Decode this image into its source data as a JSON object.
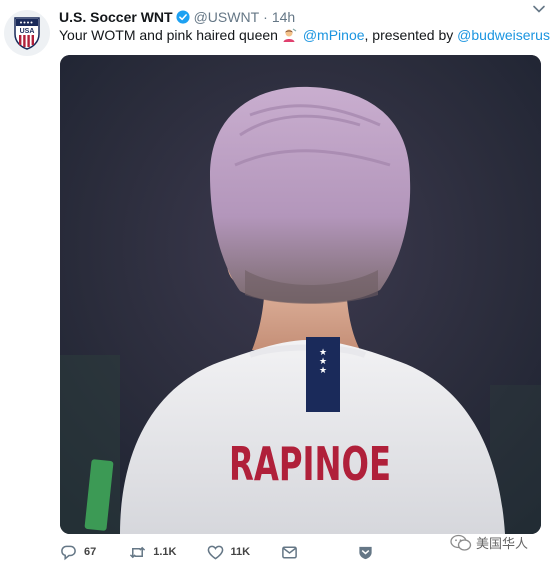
{
  "tweet": {
    "author_name": "U.S. Soccer WNT",
    "handle": "@USWNT",
    "separator": "·",
    "time": "14h",
    "text_before": "Your WOTM and pink haired queen",
    "emoji_icon": "woman-getting-haircut-icon",
    "mention_1": "@mPinoe",
    "text_middle": ", presented by",
    "mention_2": "@budweiserusa",
    "text_end": "."
  },
  "media": {
    "jersey_name": "RAPINOE",
    "image_subject": "player-back-photo"
  },
  "actions": {
    "replies": "67",
    "retweets": "1.1K",
    "likes": "11K"
  },
  "watermark": {
    "text": "美国华人"
  },
  "colors": {
    "link": "#1b95e0",
    "verified": "#1da1f2",
    "hair": "#b79bbd",
    "jersey_name": "#b0203a",
    "navy": "#1a2a5a"
  }
}
